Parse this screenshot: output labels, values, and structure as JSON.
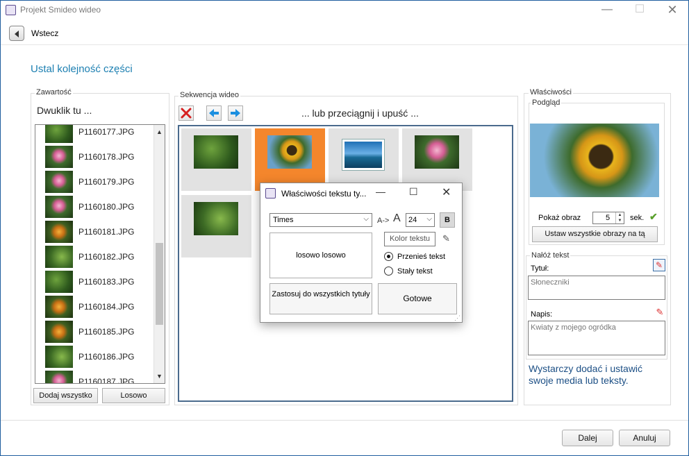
{
  "window": {
    "title": "Projekt Smideo wideo",
    "minimize": "—",
    "maximize": "☐",
    "close": "✕"
  },
  "nav": {
    "back_label": "Wstecz"
  },
  "heading": "Ustal kolejność części",
  "content_panel": {
    "label": "Zawartość",
    "hint": "Dwuklik tu ...",
    "files": [
      "P1160177.JPG",
      "P1160178.JPG",
      "P1160179.JPG",
      "P1160180.JPG",
      "P1160181.JPG",
      "P1160182.JPG",
      "P1160183.JPG",
      "P1160184.JPG",
      "P1160185.JPG",
      "P1160186.JPG",
      "P1160187.JPG"
    ],
    "add_all_label": "Dodaj wszystko",
    "random_label": "Losowo"
  },
  "sequence_panel": {
    "label": "Sekwencja wideo",
    "drag_hint": "... lub przeciągnij i upuść ...",
    "tiles": [
      "grn1",
      "sunf",
      "sea",
      "pinkf",
      "grn2"
    ],
    "selected_index": 1
  },
  "properties_panel": {
    "label": "Właściwości",
    "preview_label": "Podgląd",
    "show_image_label": "Pokaż obraz",
    "show_image_value": "5",
    "seconds_label": "sek.",
    "set_all_label": "Ustaw wszystkie obrazy na tą",
    "overlay_label": "Nałóż tekst",
    "title_label": "Tytuł:",
    "title_value": "Słoneczniki",
    "caption_label": "Napis:",
    "caption_value": "Kwiaty z mojego ogródka",
    "info_text": "Wystarczy dodać i ustawić swoje media lub teksty."
  },
  "dialog": {
    "title": "Właściwości tekstu ty...",
    "font_value": "Times",
    "size_arrow_label": "A->",
    "size_big_a": "A",
    "size_value": "24",
    "bold_label": "B",
    "preview_text": "losowo losowo",
    "color_label": "Kolor tekstu",
    "radio_move": "Przenieś tekst",
    "radio_fixed": "Stały tekst",
    "apply_all_label": "Zastosuj do wszystkich tytuły",
    "done_label": "Gotowe",
    "minimize": "—",
    "maximize": "☐",
    "close": "✕"
  },
  "footer": {
    "next_label": "Dalej",
    "cancel_label": "Anuluj"
  },
  "colors": {
    "accent": "#1c7fb1",
    "selected_tile": "#f4862c",
    "nav_arrow": "#1b8fe0",
    "delete": "#d62020"
  }
}
